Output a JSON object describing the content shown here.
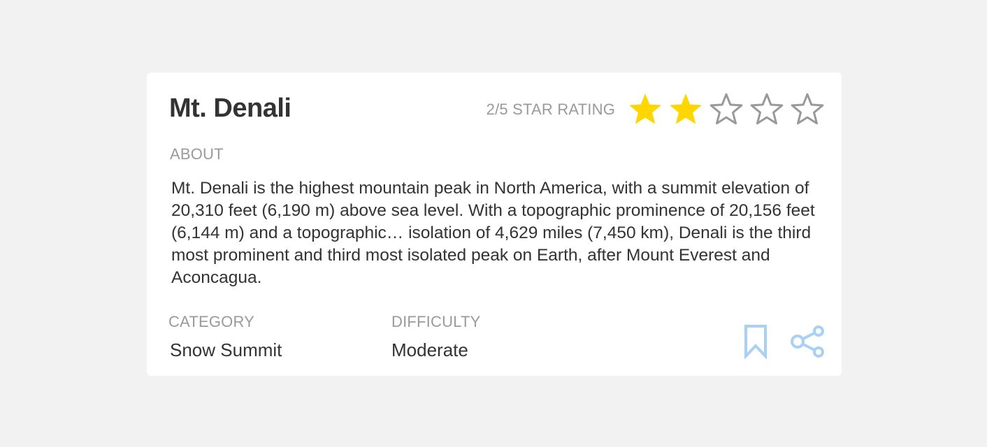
{
  "card": {
    "title": "Mt. Denali",
    "rating": {
      "label": "2/5 STAR RATING",
      "value": 2,
      "max": 5,
      "filled_color": "#FFD600",
      "empty_color": "#999999"
    },
    "about": {
      "label": "ABOUT",
      "text": "Mt. Denali is the highest mountain peak in North America, with a summit elevation of 20,310 feet (6,190 m) above sea level. With a topographic prominence of 20,156 feet (6,144 m) and a topographic… isolation of 4,629 miles (7,450 km), Denali is the third most prominent and third most isolated peak on Earth, after Mount Everest and Aconcagua."
    },
    "category": {
      "label": "CATEGORY",
      "value": "Snow Summit"
    },
    "difficulty": {
      "label": "DIFFICULTY",
      "value": "Moderate"
    },
    "actions": {
      "bookmark_icon": "bookmark-icon",
      "share_icon": "share-icon",
      "accent_color": "#A9D1F5"
    }
  }
}
